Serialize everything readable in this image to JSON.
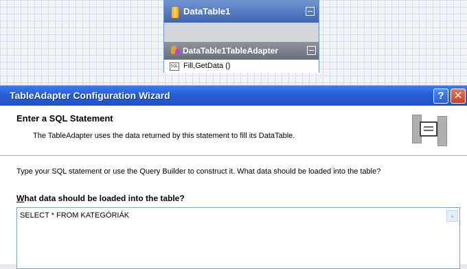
{
  "designer": {
    "datatable_title": "DataTable1",
    "tableadapter_title": "DataTable1TableAdapter",
    "method": "Fill,GetData ()"
  },
  "wizard": {
    "title": "TableAdapter Configuration Wizard",
    "help_label": "?",
    "close_label": "✕",
    "heading": "Enter a SQL Statement",
    "description": "The TableAdapter uses the data returned by this statement to fill its DataTable.",
    "instruction": "Type your SQL statement or use the Query Builder to construct it. What data should be loaded into the table?",
    "field_label_mnemonic": "W",
    "field_label_rest": "hat data should be loaded into the table?",
    "sql_value": "SELECT * FROM KATEGÓRIÁK",
    "scroll_up_icon": "▲"
  }
}
